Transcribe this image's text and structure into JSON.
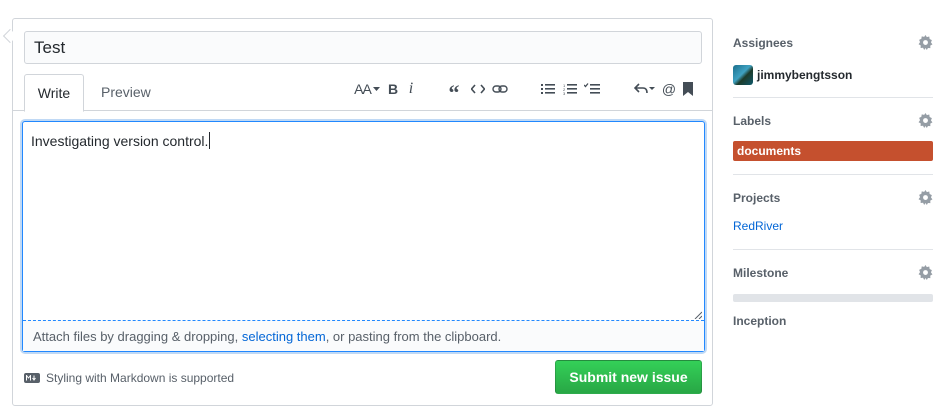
{
  "form": {
    "title_value": "Test",
    "tabs": [
      {
        "label": "Write",
        "active": true
      },
      {
        "label": "Preview",
        "active": false
      }
    ],
    "toolbar": {
      "header_glyph": "AA",
      "bold_glyph": "B",
      "italic_glyph": "i",
      "quote_glyph": "“",
      "code_glyph": "<>",
      "mention_glyph": "@",
      "icons": [
        "header-icon",
        "bold-icon",
        "italic-icon",
        "quote-icon",
        "code-icon",
        "link-icon",
        "bullet-list-icon",
        "numbered-list-icon",
        "task-list-icon",
        "reply-icon",
        "mention-icon",
        "bookmark-icon"
      ]
    },
    "body_text": "Investigating version control.",
    "dropzone": {
      "before": "Attach files by dragging & dropping, ",
      "link": "selecting them",
      "after": ", or pasting from the clipboard."
    },
    "markdown_note": "Styling with Markdown is supported",
    "submit_label": "Submit new issue"
  },
  "sidebar": {
    "assignees": {
      "heading": "Assignees",
      "user": "jimmybengtsson"
    },
    "labels": {
      "heading": "Labels",
      "label": "documents",
      "color": "#c5502e"
    },
    "projects": {
      "heading": "Projects",
      "project": "RedRiver"
    },
    "milestone": {
      "heading": "Milestone",
      "name": "Inception",
      "progress": 0
    }
  },
  "colors": {
    "accent": "#0366d6",
    "submit": "#28a745",
    "focus_border": "#2188ff"
  }
}
